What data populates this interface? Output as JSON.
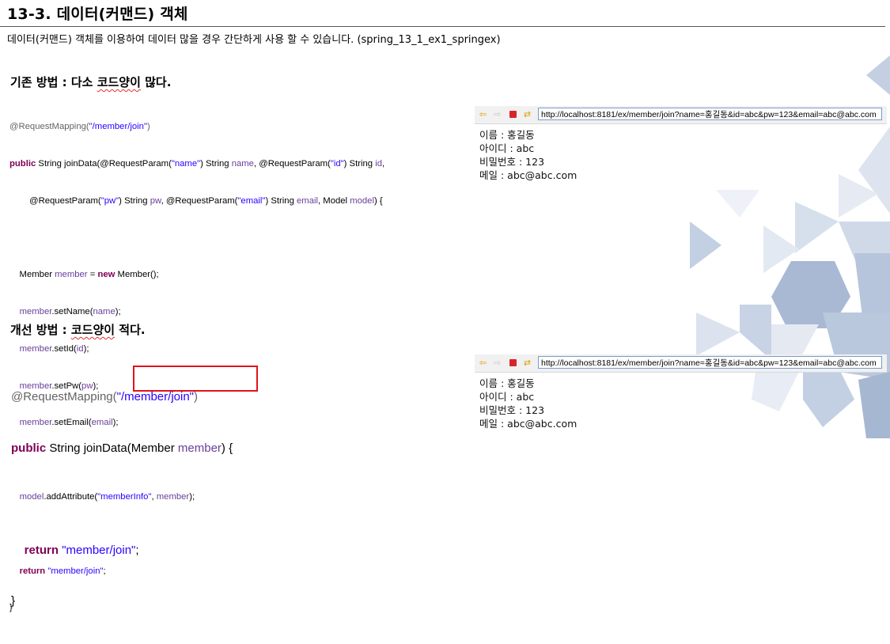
{
  "title": "13-3. 데이터(커맨드) 객체",
  "subtitle": "데이터(커맨드) 객체를 이용하여 데이터 많을 경우 간단하게 사용 할 수 있습니다. (spring_13_1_ex1_springex)",
  "section1": {
    "heading_prefix": "기존 방법 : 다소 ",
    "heading_marked": "코드양이",
    "heading_suffix": " 많다.",
    "code": {
      "l1_ann": "@RequestMapping(",
      "l1_str": "\"/member/join\"",
      "l1_end": ")",
      "l2_kw": "public",
      "l2_a": " String joinData(@RequestParam(",
      "l2_s1": "\"name\"",
      "l2_b": ") String ",
      "l2_v1": "name",
      "l2_c": ", @RequestParam(",
      "l2_s2": "\"id\"",
      "l2_d": ") String ",
      "l2_v2": "id",
      "l2_e": ",",
      "l3_a": "        @RequestParam(",
      "l3_s1": "\"pw\"",
      "l3_b": ") String ",
      "l3_v1": "pw",
      "l3_c": ", @RequestParam(",
      "l3_s2": "\"email\"",
      "l3_d": ") String ",
      "l3_v2": "email",
      "l3_e": ", Model ",
      "l3_v3": "model",
      "l3_f": ") {",
      "l5_a": "    Member ",
      "l5_v": "member",
      "l5_b": " = ",
      "l5_kw": "new",
      "l5_c": " Member();",
      "l6_v1": "member",
      "l6_a": ".setName(",
      "l6_v2": "name",
      "l6_b": ");",
      "l7_v1": "member",
      "l7_a": ".setId(",
      "l7_v2": "id",
      "l7_b": ");",
      "l8_v1": "member",
      "l8_a": ".setPw(",
      "l8_v2": "pw",
      "l8_b": ");",
      "l9_v1": "member",
      "l9_a": ".setEmail(",
      "l9_v2": "email",
      "l9_b": ");",
      "l11_v1": "model",
      "l11_a": ".addAttribute(",
      "l11_s": "\"memberInfo\"",
      "l11_b": ", ",
      "l11_v2": "member",
      "l11_c": ");",
      "l13_kw": "return",
      "l13_s": "\"member/join\"",
      "l13_b": ";",
      "l14": "}"
    }
  },
  "section2": {
    "heading_prefix": "개선 방법 : ",
    "heading_marked": "코드양이",
    "heading_suffix": " 적다.",
    "code": {
      "l1_ann": "@RequestMapping(",
      "l1_str": "\"/member/join\"",
      "l1_end": ")",
      "l2_kw": "public",
      "l2_a": " String joinData(Member ",
      "l2_v": "member",
      "l2_b": ") {",
      "l4_kw": "return",
      "l4_s": "\"member/join\"",
      "l4_b": ";",
      "l5": "}"
    }
  },
  "browser1": {
    "url": "http://localhost:8181/ex/member/join?name=홍길동&id=abc&pw=123&email=abc@abc.com",
    "lines": [
      "이름 : 홍길동",
      "아이디 : abc",
      "비밀번호 : 123",
      "메일 : abc@abc.com"
    ]
  },
  "browser2": {
    "url": "http://localhost:8181/ex/member/join?name=홍길동&id=abc&pw=123&email=abc@abc.com",
    "lines": [
      "이름 : 홍길동",
      "아이디 : abc",
      "비밀번호 : 123",
      "메일 : abc@abc.com"
    ]
  },
  "icons": {
    "back": "back-arrow-icon",
    "forward": "forward-arrow-icon",
    "stop": "stop-icon",
    "refresh": "refresh-icon"
  },
  "colors": {
    "annotation": "#646464",
    "keyword": "#7f0055",
    "string": "#2a00ff",
    "variable": "#6a3e9a",
    "highlight": "#e0141c",
    "deco": "#b8c6dc"
  }
}
